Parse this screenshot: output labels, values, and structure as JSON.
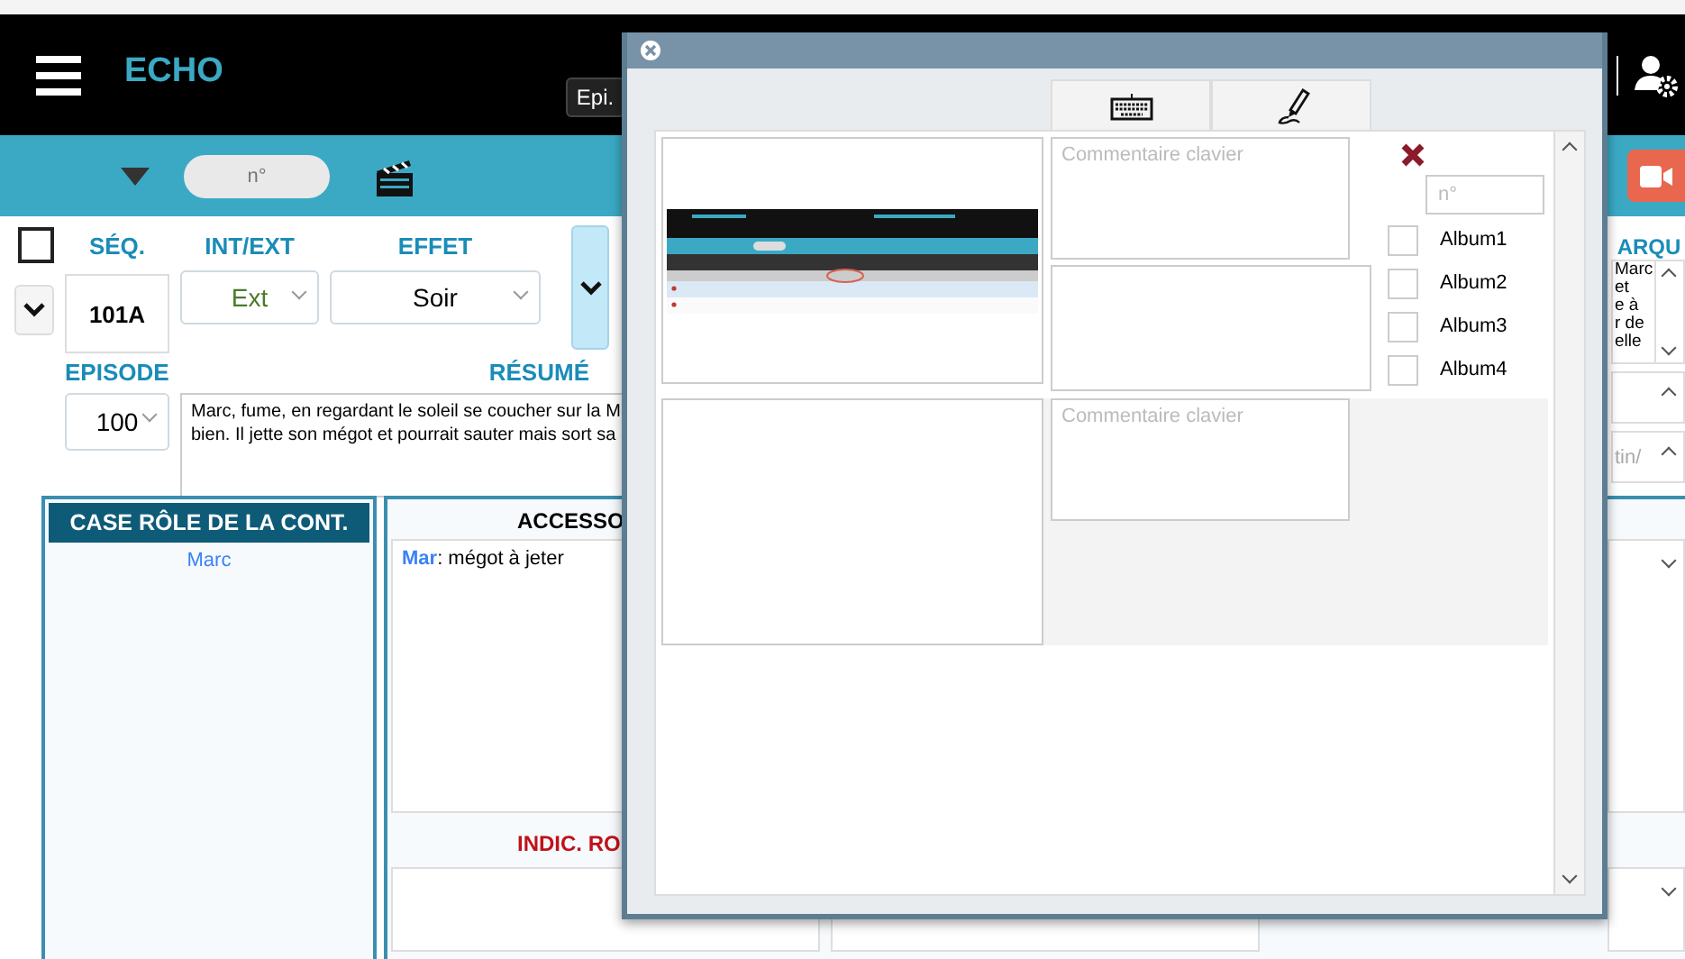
{
  "header": {
    "title": "ECHO",
    "episode_button": "Epi."
  },
  "toolbar": {
    "number_placeholder": "n°"
  },
  "sequence": {
    "checked": false,
    "seq_label": "SÉQ.",
    "int_ext_label": "INT/EXT",
    "effect_label": "EFFET",
    "seq": "101A",
    "int_ext": "Ext",
    "effect": "Soir",
    "episode_label": "EPISODE",
    "episode": "100",
    "summary_label": "RÉSUMÉ",
    "summary_lines": [
      "Marc, fume, en regardant le soleil se coucher sur la M",
      "bien. Il jette son mégot et pourrait sauter mais sort sa"
    ]
  },
  "side_column": {
    "heading": "ARQU",
    "text_lines": [
      "Marc",
      "et",
      "e à",
      "r de",
      "elle"
    ],
    "field_text": "tin/"
  },
  "roles_panel": {
    "heading": "CASE RÔLE DE LA CONT.",
    "items": [
      "Marc"
    ]
  },
  "accessories_panel": {
    "heading": "ACCESSO",
    "entries": [
      {
        "name": "Mar",
        "text": ": mégot à jeter"
      }
    ],
    "indications_heading": "INDIC. RO"
  },
  "modal": {
    "tabs": [
      {
        "kind": "keyboard"
      },
      {
        "kind": "pen"
      }
    ],
    "photos": [
      {
        "kind": "picture",
        "comment_placeholder": "Commentaire clavier"
      },
      {
        "kind": "empty",
        "comment_placeholder": "Commentaire clavier"
      }
    ],
    "number_placeholder": "n°",
    "albums": [
      {
        "label": "Album1",
        "checked": false
      },
      {
        "label": "Album2",
        "checked": false
      },
      {
        "label": "Album3",
        "checked": false
      },
      {
        "label": "Album4",
        "checked": false
      }
    ]
  }
}
